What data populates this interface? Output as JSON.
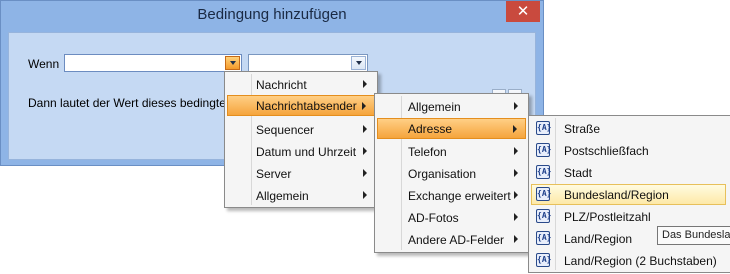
{
  "dialog": {
    "title": "Bedingung hinzufügen",
    "close_symbol": "✕",
    "wenn_label": "Wenn",
    "dann_label": "Dann lautet der Wert dieses bedingten Fe"
  },
  "menu1": {
    "items": [
      {
        "label": "Nachricht",
        "submenu": true
      },
      {
        "label": "Nachrichtabsender",
        "submenu": true
      },
      {
        "label": "Sequencer",
        "submenu": true
      },
      {
        "label": "Datum und Uhrzeit",
        "submenu": true
      },
      {
        "label": "Server",
        "submenu": true
      },
      {
        "label": "Allgemein",
        "submenu": true
      }
    ]
  },
  "menu2": {
    "items": [
      {
        "label": "Allgemein",
        "submenu": true
      },
      {
        "label": "Adresse",
        "submenu": true
      },
      {
        "label": "Telefon",
        "submenu": true
      },
      {
        "label": "Organisation",
        "submenu": true
      },
      {
        "label": "Exchange erweitert",
        "submenu": true
      },
      {
        "label": "AD-Fotos",
        "submenu": true
      },
      {
        "label": "Andere AD-Felder",
        "submenu": true
      }
    ]
  },
  "menu3": {
    "icon": "active-directory-field-icon",
    "icon_glyph": "{A}",
    "items": [
      {
        "label": "Straße"
      },
      {
        "label": "Postschließfach"
      },
      {
        "label": "Stadt"
      },
      {
        "label": "Bundesland/Region"
      },
      {
        "label": "PLZ/Postleitzahl"
      },
      {
        "label": "Land/Region"
      },
      {
        "label": "Land/Region (2 Buchstaben)"
      }
    ]
  },
  "tooltip": {
    "text": "Das Bundesla"
  },
  "colors": {
    "title_bar": "#8eb4e6",
    "client_area": "#c5d9f3",
    "close_button": "#c94a3e",
    "menu_highlight": "#f5a43c",
    "hover_highlight": "#fde9a8"
  }
}
